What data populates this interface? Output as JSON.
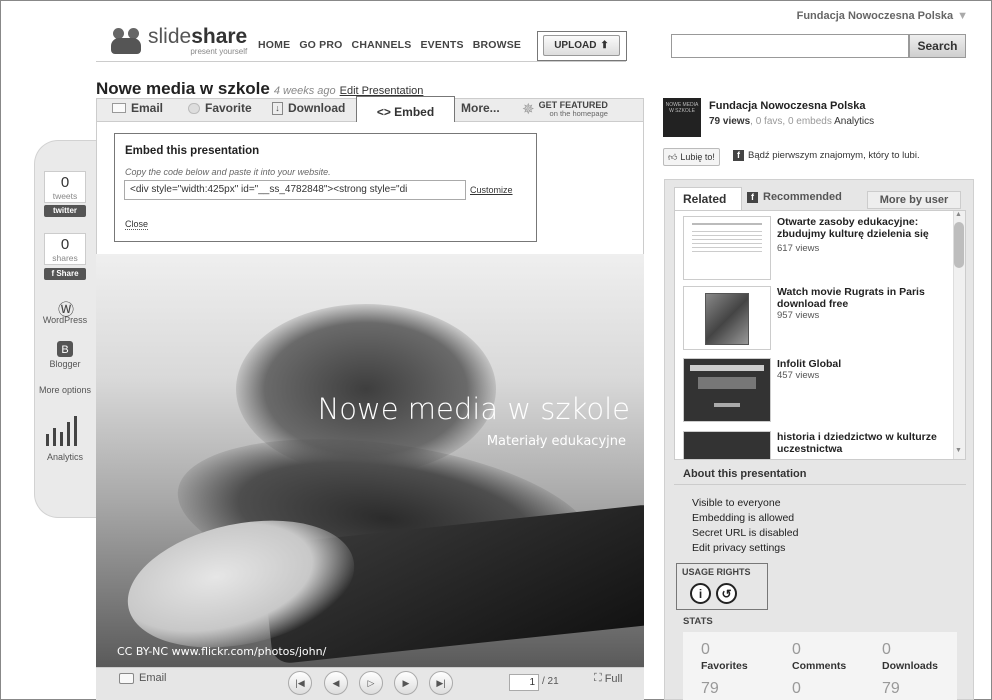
{
  "account": {
    "name": "Fundacja Nowoczesna Polska",
    "caret": "▼"
  },
  "logo": {
    "name_light": "slide",
    "name_bold": "share",
    "tagline": "present yourself"
  },
  "nav": [
    "HOME",
    "GO PRO",
    "CHANNELS",
    "EVENTS",
    "BROWSE"
  ],
  "upload": {
    "label": "UPLOAD",
    "icon": "up-arrow-icon",
    "glyph": "⬆"
  },
  "search": {
    "placeholder": "",
    "button": "Search"
  },
  "presentation": {
    "title": "Nowe media w szkole",
    "age": "4 weeks ago",
    "edit": "Edit Presentation"
  },
  "actions": {
    "email": "Email",
    "favorite": "Favorite",
    "download": "Download",
    "embed": "<> Embed",
    "more": "More...",
    "featured_line1": "GET FEATURED",
    "featured_line2": "on the homepage"
  },
  "embed": {
    "heading": "Embed this presentation",
    "hint": "Copy the code below and paste it into your website.",
    "code": "<div style=\"width:425px\" id=\"__ss_4782848\"><strong style=\"di",
    "customize": "Customize",
    "close": "Close"
  },
  "share": {
    "tweets_count": "0",
    "tweets_label": "tweets",
    "twitter_badge": "twitter",
    "shares_count": "0",
    "shares_label": "shares",
    "fb_badge": "f Share",
    "wordpress": "WordPress",
    "blogger": "Blogger",
    "more_options": "More options",
    "analytics": "Analytics"
  },
  "slide": {
    "title": "Nowe media w szkole",
    "subtitle": "Materiały edukacyjne",
    "credit": "CC BY-NC  www.flickr.com/photos/john/"
  },
  "player": {
    "email": "Email",
    "current_page": "1",
    "total": "/ 21",
    "full": "Full"
  },
  "author": {
    "name": "Fundacja Nowoczesna Polska",
    "views": "79 views",
    "details": ", 0 favs, 0 embeds",
    "analytics": "Analytics",
    "thumb_text": "NOWE MEDIA W SZKOLE"
  },
  "facebook": {
    "like": "Lubię to!",
    "first_text": "Bądź pierwszym znajomym, który to lubi."
  },
  "related": {
    "tabs": {
      "related": "Related",
      "recommended": "Recommended",
      "more_by_user": "More by user"
    },
    "items": [
      {
        "title": "Otwarte zasoby edukacyjne: zbudujmy kulturę dzielenia się",
        "views": "617 views"
      },
      {
        "title": "Watch movie Rugrats in Paris download free",
        "views": "957 views"
      },
      {
        "title": "Infolit Global",
        "views": "457 views"
      },
      {
        "title": "historia i dziedzictwo w kulturze uczestnictwa",
        "views": ""
      }
    ]
  },
  "about": {
    "heading": "About this presentation",
    "lines": [
      "Visible to everyone",
      "Embedding is allowed",
      "Secret URL is disabled",
      "Edit privacy settings"
    ],
    "usage_rights": "USAGE RIGHTS"
  },
  "stats": {
    "heading": "STATS",
    "favorites": {
      "n": "0",
      "label": "Favorites",
      "v": "79"
    },
    "comments": {
      "n": "0",
      "label": "Comments",
      "v": "0"
    },
    "downloads": {
      "n": "0",
      "label": "Downloads",
      "v": "79"
    }
  }
}
